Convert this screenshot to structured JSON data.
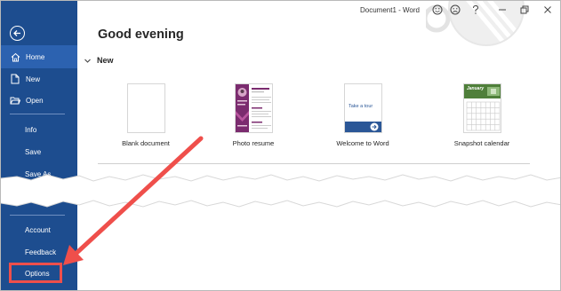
{
  "window": {
    "title": "Document1  -  Word",
    "icons": [
      "smile-icon",
      "frown-icon",
      "help-icon",
      "minimize-icon",
      "restore-icon",
      "close-icon"
    ]
  },
  "sidebar": {
    "background": "#1d4d8f",
    "items": [
      {
        "label": "Home",
        "icon": "home-icon",
        "active": true
      },
      {
        "label": "New",
        "icon": "new-document-icon"
      },
      {
        "label": "Open",
        "icon": "open-folder-icon"
      },
      {
        "label": "Info"
      },
      {
        "label": "Save"
      },
      {
        "label": "Save As"
      },
      {
        "label": "Account"
      },
      {
        "label": "Feedback"
      },
      {
        "label": "Options"
      }
    ]
  },
  "main": {
    "greeting": "Good evening",
    "new_section": "New",
    "templates": [
      {
        "label": "Blank document"
      },
      {
        "label": "Photo resume"
      },
      {
        "label": "Welcome to Word",
        "thumb_text": "Take a tour"
      },
      {
        "label": "Snapshot calendar",
        "thumb_text": "January"
      }
    ]
  },
  "annotation": {
    "arrow_color": "#ef4f4b",
    "highlight": "Options"
  }
}
